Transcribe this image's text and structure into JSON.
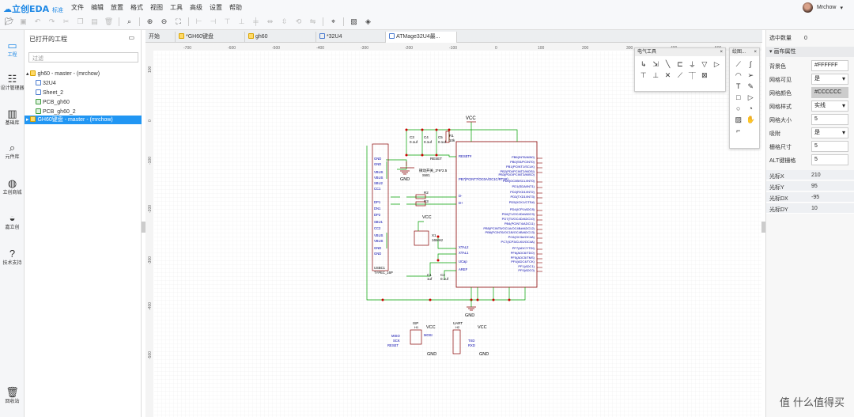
{
  "app": {
    "logo": "立创EDA",
    "edition": "标准"
  },
  "menu": [
    "文件",
    "编辑",
    "放置",
    "格式",
    "视图",
    "工具",
    "高级",
    "设置",
    "帮助"
  ],
  "user": {
    "name": "Mrchow"
  },
  "toolbar": [
    "folder-open-icon",
    "save-icon",
    "undo-icon",
    "redo-icon",
    "cut-icon",
    "copy-icon",
    "paste-icon",
    "delete-icon",
    "search-icon",
    "zoom-in-icon",
    "zoom-out-icon",
    "fit-icon",
    "align-icons",
    "pointer-icon",
    "image-icon",
    "layers-icon"
  ],
  "leftnav": [
    {
      "label": "工程",
      "icon": "folder-icon",
      "active": true
    },
    {
      "label": "设计管理器",
      "icon": "hierarchy-icon"
    },
    {
      "label": "基础库",
      "icon": "chip-icon"
    },
    {
      "label": "元件库",
      "icon": "search-icon"
    },
    {
      "label": "立创商城",
      "icon": "lcsc-icon"
    },
    {
      "label": "嘉立创",
      "icon": "jlc-icon"
    },
    {
      "label": "技术支持",
      "icon": "help-icon"
    },
    {
      "label": "回收站",
      "icon": "trash-icon"
    }
  ],
  "project": {
    "title": "已打开的工程",
    "filter_placeholder": "过滤",
    "tree": [
      {
        "label": "gh60 - master - (mrchow)",
        "type": "folder",
        "level": 0
      },
      {
        "label": "32U4",
        "type": "sheet",
        "level": 1
      },
      {
        "label": "Sheet_2",
        "type": "sheet",
        "level": 1
      },
      {
        "label": "PCB_gh60",
        "type": "pcb",
        "level": 1
      },
      {
        "label": "PCB_gh60_2",
        "type": "pcb",
        "level": 1
      },
      {
        "label": "GH60键盘 - master - (mrchow)",
        "type": "folder",
        "level": 0,
        "selected": true
      }
    ]
  },
  "tabs": [
    {
      "label": "开始"
    },
    {
      "label": "*GH60键盘"
    },
    {
      "label": "gh60"
    },
    {
      "label": "*32U4"
    },
    {
      "label": "ATMage32U4最...",
      "active": true
    }
  ],
  "ruler": {
    "top": [
      "-700",
      "-600",
      "-500",
      "-400",
      "-300",
      "-200",
      "-100",
      "0",
      "100",
      "200",
      "300",
      "400",
      "500",
      "600",
      "700",
      "800",
      "900"
    ],
    "left": [
      "100",
      "0",
      "-100",
      "-200",
      "-300",
      "-400",
      "-500"
    ]
  },
  "electric_tools": {
    "title": "电气工具",
    "icons": [
      "wire-icon",
      "bus-icon",
      "bus-entry-icon",
      "netlabel-icon",
      "netflag-gnd-icon",
      "netflag-vcc-icon",
      "netport-icon",
      "voltage-probe-icon",
      "pin-icon",
      "no-connect-icon",
      "group-icon",
      "ungroup-icon",
      "footprint-icon"
    ]
  },
  "draw_tools": {
    "title": "绘图...",
    "icons": [
      "polyline-icon",
      "bezier-icon",
      "arc-icon",
      "arrow-icon",
      "text-icon",
      "freehand-icon",
      "rect-icon",
      "poly-icon",
      "circle-icon",
      "pie-icon",
      "image-icon",
      "drag-icon",
      "origin-icon"
    ]
  },
  "right": {
    "selected_label": "选中数量",
    "selected_count": "0",
    "section": "画布属性",
    "props": [
      {
        "label": "背景色",
        "value": "#FFFFFF"
      },
      {
        "label": "网格可见",
        "value": "是",
        "dropdown": true
      },
      {
        "label": "网格颜色",
        "value": "#CCCCCC",
        "gray": true
      },
      {
        "label": "网格样式",
        "value": "实线",
        "dropdown": true
      },
      {
        "label": "网格大小",
        "value": "5"
      },
      {
        "label": "吸附",
        "value": "是",
        "dropdown": true
      },
      {
        "label": "栅格尺寸",
        "value": "5"
      },
      {
        "label": "ALT键栅格",
        "value": "5"
      }
    ],
    "cursor": [
      {
        "label": "光标X",
        "value": "210"
      },
      {
        "label": "光标Y",
        "value": "95"
      },
      {
        "label": "光标DX",
        "value": "-95"
      },
      {
        "label": "光标DY",
        "value": "10"
      }
    ]
  },
  "schematic": {
    "vcc": "VCC",
    "gnd": "GND",
    "mcu_pins_left": [
      "RESET#",
      "PB7(PCINT7/OC0A/OC1C/RTS#)",
      "D-",
      "D+",
      "XTAL2",
      "XTAL1",
      "UCap",
      "AREF"
    ],
    "mcu_pins_right": [
      "PB6(INT6/AIN0)",
      "PB0(SS/PCINT0)",
      "PB1(PCINT1/SCLK)",
      "PB2(PDI/PCINT2/MOSI)",
      "PB3(PDO/PCINT3/MISO)",
      "PD0(OC0B/SCL/INT0)",
      "PD1(SDA/INT1)",
      "PD2(RXD1/INT2)",
      "PD3(TXD1/INT3)",
      "PD5(XCK1/CTS#)",
      "PD4(ICP1/ADC8)",
      "PD6(T1/OC4D#/ADC9)",
      "PD7(T0/OC4D/ADC10)",
      "PB4(PCINT4/ADC11)",
      "PB5(PCINT5/OC1A/OC4B#/ADC12)",
      "PB6(PCINT6/OC1B/OC4B/ADC13)",
      "PC6(OC3A/OC4A)",
      "PC7(ICP3/CLK0/OC4A)",
      "PF7(ADC7/TDI)",
      "PF6(ADC6/TDO)",
      "PF5(ADC5/TMS)",
      "PF4(ADC4/TCK)",
      "PF1(ADC1)",
      "PF0(ADC0)"
    ],
    "usb_pins": [
      "GND",
      "GND",
      "VBUS",
      "VBUS",
      "SBU2",
      "CC1",
      "DP1",
      "DN1",
      "DP2",
      "SBU1",
      "CC2",
      "VBUS",
      "VBUS",
      "GND",
      "GND"
    ],
    "usb_label": "TYPEC_16P",
    "usb_ref": "USBC1",
    "caps": [
      "C3",
      "0.1uf",
      "C4",
      "0.1uf",
      "C5",
      "0.1uf",
      "C1",
      "1uf",
      "C2",
      "0.1uf"
    ],
    "r1": "R1",
    "r1v": "10k",
    "reset": "RESET",
    "sw": "SW1",
    "sw_name": "微动开关_3*6*2.5",
    "crystal": "X1",
    "crystal_v": "16MHz",
    "isp": "ISP",
    "isp_pins": [
      "MISO",
      "SCK",
      "RESET",
      "MOSI"
    ],
    "isp_ref": "H1",
    "uart": "UART",
    "uart_pins": [
      "TXD",
      "RXD"
    ],
    "uart_ref": "H2",
    "r2": "R2",
    "r3": "R3"
  },
  "watermark": "值 什么值得买"
}
